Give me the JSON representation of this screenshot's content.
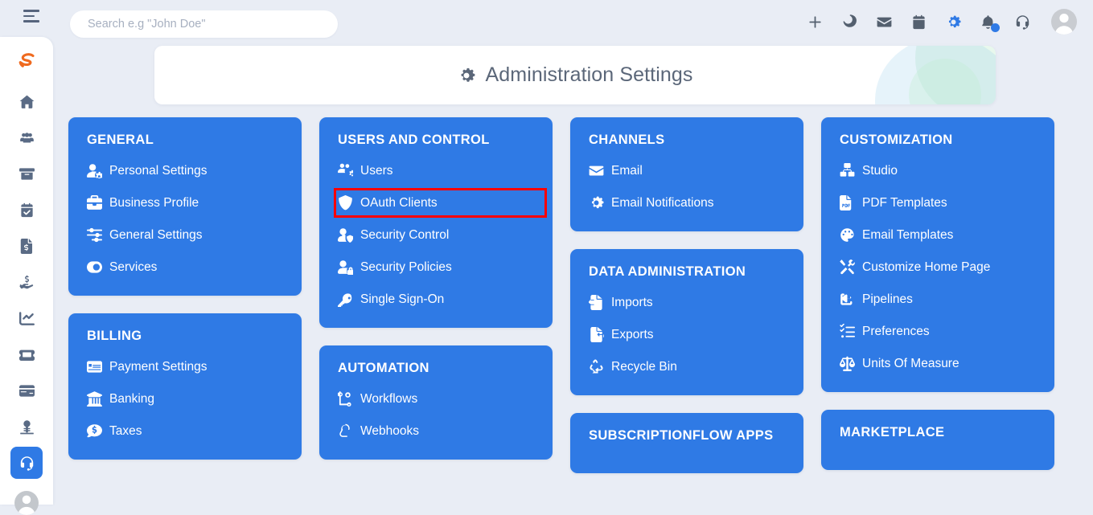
{
  "topbar": {
    "menu_icon": "hamburger-icon",
    "search": {
      "placeholder": "Search e.g \"John Doe\"",
      "value": ""
    },
    "icons": [
      {
        "name": "plus-icon",
        "accent": false,
        "badge": false
      },
      {
        "name": "moon-icon",
        "accent": false,
        "badge": false
      },
      {
        "name": "envelope-icon",
        "accent": false,
        "badge": false
      },
      {
        "name": "calendar-icon",
        "accent": false,
        "badge": false
      },
      {
        "name": "gear-icon",
        "accent": true,
        "badge": false
      },
      {
        "name": "bell-icon",
        "accent": false,
        "badge": true
      },
      {
        "name": "headset-icon",
        "accent": false,
        "badge": false
      }
    ],
    "avatar": "user-avatar"
  },
  "sidebar": {
    "logo": "subscriptionflow-logo",
    "items": [
      {
        "icon": "home-icon",
        "active": false
      },
      {
        "icon": "users-icon",
        "active": false
      },
      {
        "icon": "archive-box-icon",
        "active": false
      },
      {
        "icon": "calendar-check-icon",
        "active": false
      },
      {
        "icon": "invoice-icon",
        "active": false
      },
      {
        "icon": "hand-dollar-icon",
        "active": false
      },
      {
        "icon": "chart-line-icon",
        "active": false
      },
      {
        "icon": "ticket-icon",
        "active": false
      },
      {
        "icon": "credit-card-icon",
        "active": false
      },
      {
        "icon": "money-stamp-icon",
        "active": false
      },
      {
        "icon": "headset-icon",
        "active": true
      }
    ],
    "avatar": "user-avatar"
  },
  "header": {
    "icon": "gear-icon",
    "title": "Administration Settings"
  },
  "colors": {
    "card_blue": "#2f7ae5",
    "page_background": "#e9edf5",
    "highlight_red": "#ff0000",
    "accent_blue": "#2f7ae5",
    "logo_orange": "#ef6a1f",
    "title_text": "#5b6779"
  },
  "columns": [
    {
      "cards": [
        {
          "title": "GENERAL",
          "links": [
            {
              "label": "Personal Settings",
              "icon": "user-gear-icon",
              "highlighted": false
            },
            {
              "label": "Business Profile",
              "icon": "briefcase-icon",
              "highlighted": false
            },
            {
              "label": "General Settings",
              "icon": "sliders-icon",
              "highlighted": false
            },
            {
              "label": "Services",
              "icon": "toggle-on-icon",
              "highlighted": false
            }
          ]
        },
        {
          "title": "BILLING",
          "links": [
            {
              "label": "Payment Settings",
              "icon": "money-check-icon",
              "highlighted": false
            },
            {
              "label": "Banking",
              "icon": "bank-icon",
              "highlighted": false
            },
            {
              "label": "Taxes",
              "icon": "comment-dollar-icon",
              "highlighted": false
            }
          ]
        }
      ]
    },
    {
      "cards": [
        {
          "title": "USERS AND CONTROL",
          "links": [
            {
              "label": "Users",
              "icon": "users-gear-icon",
              "highlighted": false
            },
            {
              "label": "OAuth Clients",
              "icon": "shield-icon",
              "highlighted": true
            },
            {
              "label": "Security Control",
              "icon": "user-shield-icon",
              "highlighted": false
            },
            {
              "label": "Security Policies",
              "icon": "user-lock-icon",
              "highlighted": false
            },
            {
              "label": "Single Sign-On",
              "icon": "key-icon",
              "highlighted": false
            }
          ]
        },
        {
          "title": "AUTOMATION",
          "links": [
            {
              "label": "Workflows",
              "icon": "workflow-icon",
              "highlighted": false
            },
            {
              "label": "Webhooks",
              "icon": "webhook-icon",
              "highlighted": false
            }
          ]
        }
      ]
    },
    {
      "cards": [
        {
          "title": "CHANNELS",
          "links": [
            {
              "label": "Email",
              "icon": "envelope-icon",
              "highlighted": false
            },
            {
              "label": "Email Notifications",
              "icon": "gear-icon",
              "highlighted": false
            }
          ]
        },
        {
          "title": "DATA ADMINISTRATION",
          "links": [
            {
              "label": "Imports",
              "icon": "file-import-icon",
              "highlighted": false
            },
            {
              "label": "Exports",
              "icon": "file-export-icon",
              "highlighted": false
            },
            {
              "label": "Recycle Bin",
              "icon": "recycle-icon",
              "highlighted": false
            }
          ]
        },
        {
          "title": "SUBSCRIPTIONFLOW APPS",
          "links": []
        }
      ]
    },
    {
      "cards": [
        {
          "title": "CUSTOMIZATION",
          "links": [
            {
              "label": "Studio",
              "icon": "studio-icon",
              "highlighted": false
            },
            {
              "label": "PDF Templates",
              "icon": "file-pdf-icon",
              "highlighted": false
            },
            {
              "label": "Email Templates",
              "icon": "palette-icon",
              "highlighted": false
            },
            {
              "label": "Customize Home Page",
              "icon": "tools-icon",
              "highlighted": false
            },
            {
              "label": "Pipelines",
              "icon": "share-icon",
              "highlighted": false
            },
            {
              "label": "Preferences",
              "icon": "list-check-icon",
              "highlighted": false
            },
            {
              "label": "Units Of Measure",
              "icon": "balance-scale-icon",
              "highlighted": false
            }
          ]
        },
        {
          "title": "MARKETPLACE",
          "links": []
        }
      ]
    }
  ]
}
